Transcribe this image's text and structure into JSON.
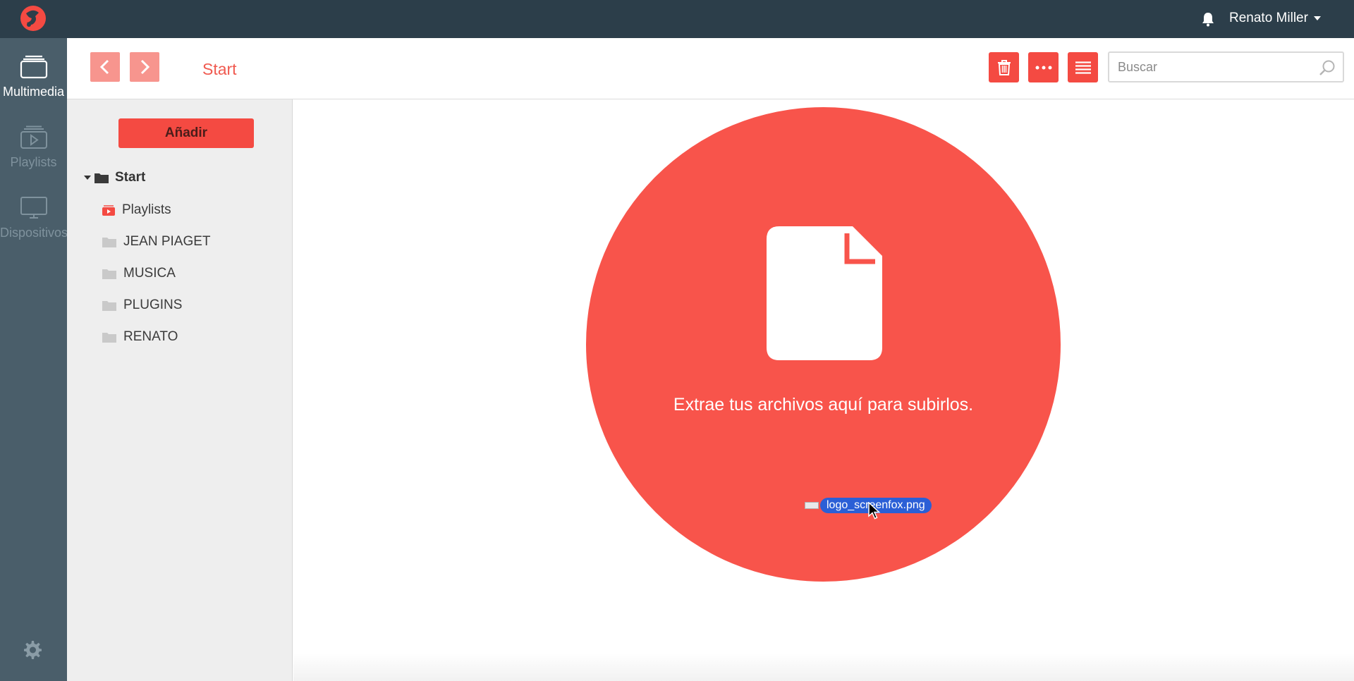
{
  "app": {
    "logo_icon": "brand-logo-icon",
    "accent_color": "#f44a42",
    "topbar_color": "#2c3e4a"
  },
  "topbar": {
    "notification_icon": "bell-icon",
    "user_name": "Renato Miller"
  },
  "rail": {
    "items": [
      {
        "label": "Multimedia",
        "icon": "folder-stack-icon",
        "active": true
      },
      {
        "label": "Playlists",
        "icon": "playlist-icon",
        "active": false
      },
      {
        "label": "Dispositivos",
        "icon": "monitor-icon",
        "active": false
      }
    ],
    "settings_icon": "gear-icon"
  },
  "header": {
    "back_icon": "chevron-left-icon",
    "forward_icon": "chevron-right-icon",
    "breadcrumb": "Start",
    "tools": [
      {
        "name": "delete",
        "icon": "trash-icon"
      },
      {
        "name": "more",
        "icon": "ellipsis-icon"
      },
      {
        "name": "list-view",
        "icon": "list-icon"
      }
    ],
    "search_placeholder": "Buscar",
    "search_icon": "magnifier-icon"
  },
  "tree": {
    "add_label": "Añadir",
    "root_label": "Start",
    "items": [
      {
        "label": "Playlists",
        "icon": "playlist-folder-icon"
      },
      {
        "label": "JEAN PIAGET",
        "icon": "folder-icon"
      },
      {
        "label": "MUSICA",
        "icon": "folder-icon"
      },
      {
        "label": "PLUGINS",
        "icon": "folder-icon"
      },
      {
        "label": "RENATO",
        "icon": "folder-icon"
      }
    ]
  },
  "dropzone": {
    "message": "Extrae tus archivos aquí para subirlos.",
    "file_icon": "document-icon",
    "dragged_file": "logo_screenfox.png"
  }
}
